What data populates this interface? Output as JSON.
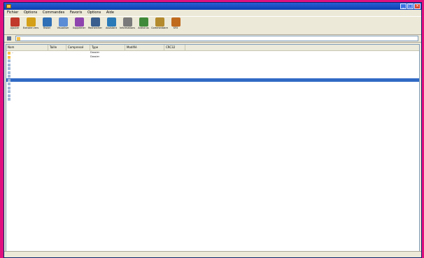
{
  "window": {
    "title": "",
    "minimize": "_",
    "maximize": "□",
    "close": "×"
  },
  "menu": [
    "Fichier",
    "Options",
    "Commandes",
    "Favoris",
    "Options",
    "Aide"
  ],
  "toolbar": [
    {
      "label": "Ajouter",
      "color": "#c0392b",
      "icon": "add-archive-icon"
    },
    {
      "label": "Extraire vers",
      "color": "#d4a017",
      "icon": "extract-icon"
    },
    {
      "label": "Tester",
      "color": "#2e6fb5",
      "icon": "test-icon"
    },
    {
      "label": "Visualiser",
      "color": "#5b8dd6",
      "icon": "view-icon"
    },
    {
      "label": "Supprimer",
      "color": "#8e44ad",
      "icon": "delete-icon"
    },
    {
      "label": "Rechercher",
      "color": "#3a5f8f",
      "icon": "find-icon"
    },
    {
      "label": "Assistant",
      "color": "#2a7ab8",
      "icon": "wizard-icon"
    },
    {
      "label": "Informations",
      "color": "#7a7a7a",
      "icon": "info-icon"
    },
    {
      "label": "Antivirus",
      "color": "#3f8a3a",
      "icon": "virus-scan-icon"
    },
    {
      "label": "Commentaire",
      "color": "#b38b2e",
      "icon": "comment-icon"
    },
    {
      "label": "SFX",
      "color": "#c06a1e",
      "icon": "sfx-icon"
    }
  ],
  "address": {
    "path": ""
  },
  "columns": [
    "Nom",
    "Taille",
    "Compressé",
    "Type",
    "Modifié",
    "CRC32"
  ],
  "rows": [
    {
      "name": "..",
      "size": "",
      "packed": "",
      "type": "Dossier",
      "modified": "",
      "crc": "",
      "icon": "#f6c14a"
    },
    {
      "name": "",
      "size": "",
      "packed": "",
      "type": "Dossier",
      "modified": "",
      "crc": "",
      "icon": "#f6c14a"
    },
    {
      "name": "",
      "size": "",
      "packed": "",
      "type": "",
      "modified": "",
      "crc": "",
      "icon": "#9fb8d8"
    },
    {
      "name": "",
      "size": "",
      "packed": "",
      "type": "",
      "modified": "",
      "crc": "",
      "icon": "#9fb8d8"
    },
    {
      "name": "",
      "size": "",
      "packed": "",
      "type": "",
      "modified": "",
      "crc": "",
      "icon": "#9fb8d8"
    },
    {
      "name": "",
      "size": "",
      "packed": "",
      "type": "",
      "modified": "",
      "crc": "",
      "icon": "#9fb8d8"
    },
    {
      "name": "",
      "size": "",
      "packed": "",
      "type": "",
      "modified": "",
      "crc": "",
      "icon": "#9fb8d8"
    },
    {
      "name": "",
      "size": "",
      "packed": "",
      "type": "",
      "modified": "",
      "crc": "",
      "icon": "#9fb8d8",
      "selected": true
    },
    {
      "name": "",
      "size": "",
      "packed": "",
      "type": "",
      "modified": "",
      "crc": "",
      "icon": "#9fb8d8"
    },
    {
      "name": "",
      "size": "",
      "packed": "",
      "type": "",
      "modified": "",
      "crc": "",
      "icon": "#9fb8d8"
    },
    {
      "name": "",
      "size": "",
      "packed": "",
      "type": "",
      "modified": "",
      "crc": "",
      "icon": "#9fb8d8"
    },
    {
      "name": "",
      "size": "",
      "packed": "",
      "type": "",
      "modified": "",
      "crc": "",
      "icon": "#9fb8d8"
    },
    {
      "name": "",
      "size": "",
      "packed": "",
      "type": "",
      "modified": "",
      "crc": "",
      "icon": "#9fb8d8"
    }
  ],
  "status": {
    "left": "",
    "right": ""
  }
}
